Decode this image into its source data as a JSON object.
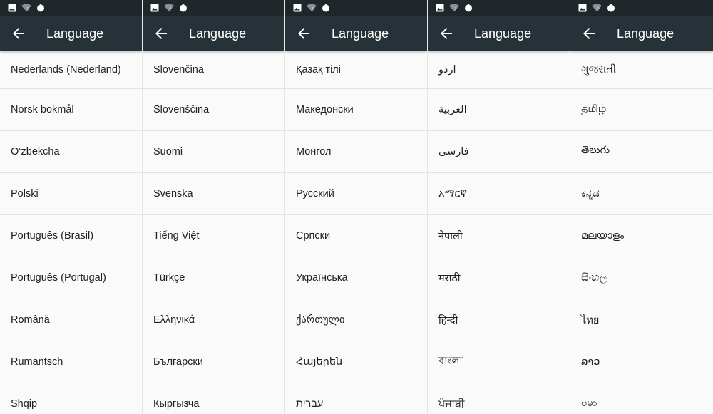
{
  "colors": {
    "status_bar": "#1f272b",
    "app_bar": "#263238",
    "title_text": "#ffffff",
    "list_background": "#fafafa",
    "item_text": "#212121",
    "divider": "#e3e3e3"
  },
  "status_icons": [
    "image-icon",
    "wifi-unknown-icon",
    "notification-drop-icon"
  ],
  "screens": [
    {
      "title": "Language",
      "back_icon": "arrow-back-icon",
      "items": [
        "Nederlands (Nederland)",
        "Norsk bokmål",
        "O‘zbekcha",
        "Polski",
        "Português (Brasil)",
        "Português (Portugal)",
        "Română",
        "Rumantsch",
        "Shqip"
      ]
    },
    {
      "title": "Language",
      "back_icon": "arrow-back-icon",
      "items": [
        "Slovenčina",
        "Slovenščina",
        "Suomi",
        "Svenska",
        "Tiếng Việt",
        "Türkçe",
        "Ελληνικά",
        "Български",
        "Кыргызча"
      ]
    },
    {
      "title": "Language",
      "back_icon": "arrow-back-icon",
      "items": [
        "Қазақ тілі",
        "Македонски",
        "Монгол",
        "Русский",
        "Српски",
        "Українська",
        "ქართული",
        "Հայերեն",
        "עברית"
      ]
    },
    {
      "title": "Language",
      "back_icon": "arrow-back-icon",
      "items": [
        "اردو",
        "العربية",
        "فارسی",
        "አማርኛ",
        "नेपाली",
        "मराठी",
        "हिन्दी",
        "বাংলা",
        "ਪੰਜਾਬੀ"
      ]
    },
    {
      "title": "Language",
      "back_icon": "arrow-back-icon",
      "items": [
        "ગુજરાતી",
        "தமிழ்",
        "తెలుగు",
        "ಕನ್ನಡ",
        "മലയാളം",
        "සිංහල",
        "ไทย",
        "ລາວ",
        "ဗမာ"
      ]
    }
  ]
}
